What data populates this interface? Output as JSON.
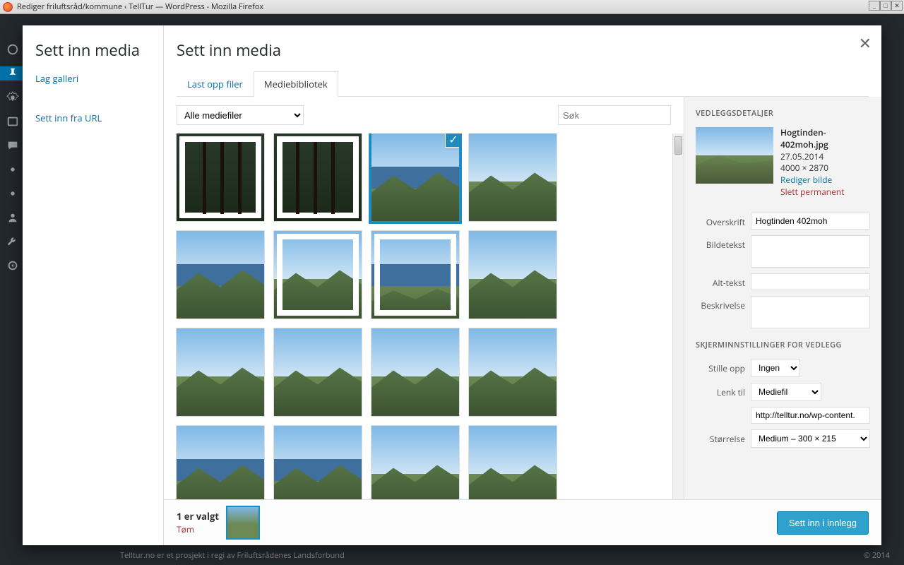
{
  "window": {
    "title": "Rediger friluftsråd/kommune ‹ TellTur — WordPress - Mozilla Firefox"
  },
  "modal": {
    "sidebar_title": "Sett inn media",
    "sidebar": {
      "create_gallery": "Lag galleri",
      "insert_from_url": "Sett inn fra URL"
    },
    "main_title": "Sett inn media",
    "tabs": {
      "upload": "Last opp filer",
      "library": "Mediebibliotek"
    },
    "filter_select": "Alle mediefiler",
    "search_placeholder": "Søk"
  },
  "details": {
    "heading": "VEDLEGGSDETALJER",
    "filename": "Hogtinden-402moh.jpg",
    "date": "27.05.2014",
    "dimensions": "4000 × 2870",
    "edit_link": "Rediger bilde",
    "delete_link": "Slett permanent",
    "labels": {
      "title": "Overskrift",
      "caption": "Bildetekst",
      "alt": "Alt-tekst",
      "description": "Beskrivelse"
    },
    "values": {
      "title": "Hogtinden 402moh"
    },
    "display_heading": "SKJERMINNSTILLINGER FOR VEDLEGG",
    "display_labels": {
      "align": "Stille opp",
      "link": "Lenk til",
      "size": "Størrelse"
    },
    "display_values": {
      "align": "Ingen",
      "link": "Mediefil",
      "url": "http://telltur.no/wp-content.",
      "size": "Medium – 300 × 215"
    }
  },
  "footer": {
    "count_text": "1 er valgt",
    "clear": "Tøm",
    "submit": "Sett inn i innlegg"
  },
  "bg_footer": {
    "left": "Telltur.no er et prosjekt i regi av Friluftsrådenes Landsforbund",
    "right": "© 2014"
  }
}
